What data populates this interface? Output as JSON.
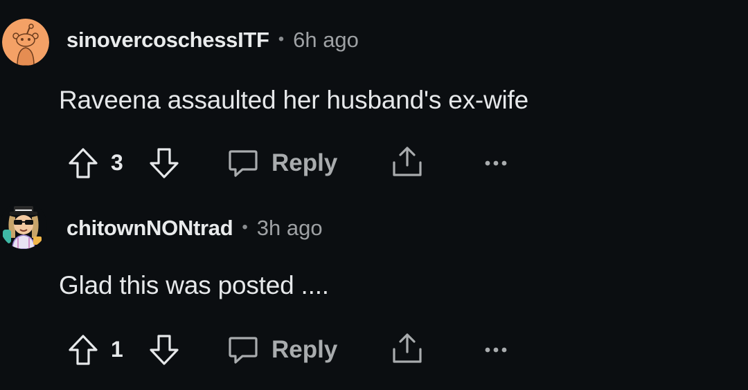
{
  "comments": [
    {
      "username": "sinovercoschessITF",
      "separator": "•",
      "timestamp": "6h ago",
      "body": "Raveena assaulted her husband's ex-wife",
      "votes": "3",
      "reply_label": "Reply",
      "avatar_icon": "snoo-avatar-icon",
      "avatar_color": "#f4a166"
    },
    {
      "username": "chitownNONtrad",
      "separator": "•",
      "timestamp": "3h ago",
      "body": "Glad this was posted ....",
      "votes": "1",
      "reply_label": "Reply",
      "avatar_icon": "custom-avatar-icon"
    }
  ],
  "icons": {
    "upvote": "upvote-arrow-icon",
    "downvote": "downvote-arrow-icon",
    "reply": "speech-bubble-icon",
    "share": "share-icon",
    "more": "more-options-icon"
  },
  "colors": {
    "background": "#0b0e11",
    "text": "#e6e8ea",
    "muted": "#9ea1a4"
  }
}
